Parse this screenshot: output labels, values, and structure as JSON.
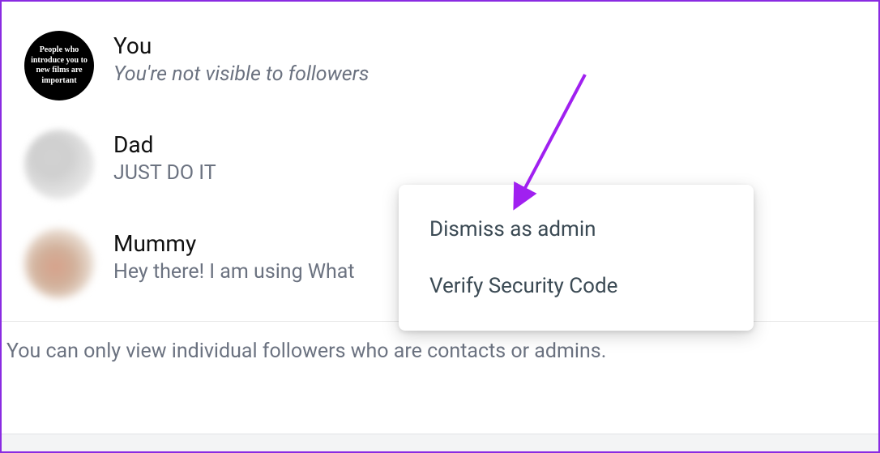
{
  "contacts": [
    {
      "name": "You",
      "subtitle": "You're not visible to followers",
      "avatar_text": "People who introduce you to new films are important"
    },
    {
      "name": "Dad",
      "subtitle": "JUST DO IT"
    },
    {
      "name": "Mummy",
      "subtitle": "Hey there! I am using What"
    }
  ],
  "popup": {
    "dismiss": "Dismiss as admin",
    "verify": "Verify Security Code"
  },
  "footer": "You can only view individual followers who are contacts or admins.",
  "annotation": {
    "arrow_color": "#a020f0"
  }
}
